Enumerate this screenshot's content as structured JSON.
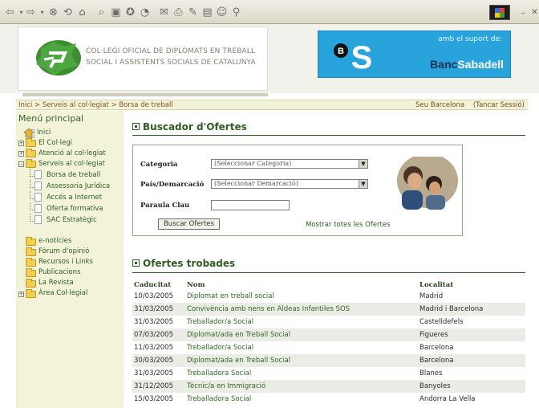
{
  "header": {
    "college_name": "COL·LEGI OFICIAL DE DIPLOMATS EN TREBALL SOCIAL I ASSISTENTS SOCIALS DE CATALUNYA",
    "sponsor_text": "amb el suport de:",
    "bank_name_part1": "Banc",
    "bank_name_part2": "Sabadell",
    "bank_color": "#29a3dc"
  },
  "breadcrumb": {
    "items": [
      "Inici",
      "Serveis al col·legiat",
      "Borsa de treball"
    ],
    "separator": ">",
    "location": "Seu Barcelona",
    "logout": "(Tancar Sessió)"
  },
  "sidebar": {
    "title": "Menú principal",
    "tree": [
      {
        "label": "Inici"
      },
      {
        "label": "El Col·legi"
      },
      {
        "label": "Atenció al col·legiat"
      },
      {
        "label": "Serveis al col·legiat"
      },
      {
        "label": "Borsa de treball"
      },
      {
        "label": "Assessoria Jurídica"
      },
      {
        "label": "Accés a Internet"
      },
      {
        "label": "Oferta formativa"
      },
      {
        "label": "SAC Estratègic"
      }
    ],
    "extra": [
      {
        "label": "e-notícies"
      },
      {
        "label": "Fòrum d'opinió"
      },
      {
        "label": "Recursos i Links"
      },
      {
        "label": "Publicacions"
      },
      {
        "label": "La Revista"
      },
      {
        "label": "Àrea Col·legial"
      }
    ]
  },
  "search": {
    "heading": "Buscador d'Ofertes",
    "category_label": "Categoria",
    "category_value": "(Seleccionar Categoria)",
    "region_label": "País/Demarcació",
    "region_value": "(Seleccionar Demarcació)",
    "keyword_label": "Paraula Clau",
    "keyword_value": "",
    "search_button": "Buscar Ofertes",
    "show_all": "Mostrar totes les Ofertes"
  },
  "results": {
    "heading": "Ofertes trobades",
    "columns": [
      "Caducitat",
      "Nom",
      "Localitat"
    ],
    "rows": [
      [
        "10/03/2005",
        "Diplomat en treball social",
        "Madrid"
      ],
      [
        "31/03/2005",
        "Convivència amb nens en Aldeas Infantiles SOS",
        "Madrid i Barcelona"
      ],
      [
        "31/03/2005",
        "Treballador/a Social",
        "Castelldefels"
      ],
      [
        "07/03/2005",
        "Diplomat/ada en Treball Social",
        "Figueres"
      ],
      [
        "11/03/2005",
        "Treballador/a Social",
        "Barcelona"
      ],
      [
        "30/03/2005",
        "Diplomat/ada en Treball Social",
        "Barcelona"
      ],
      [
        "31/03/2005",
        "Treballadora Social",
        "Blanes"
      ],
      [
        "31/12/2005",
        "Tècnic/a en Immigració",
        "Banyoles"
      ],
      [
        "15/03/2005",
        "Treballadora Social",
        "Andorra La Vella"
      ]
    ]
  }
}
